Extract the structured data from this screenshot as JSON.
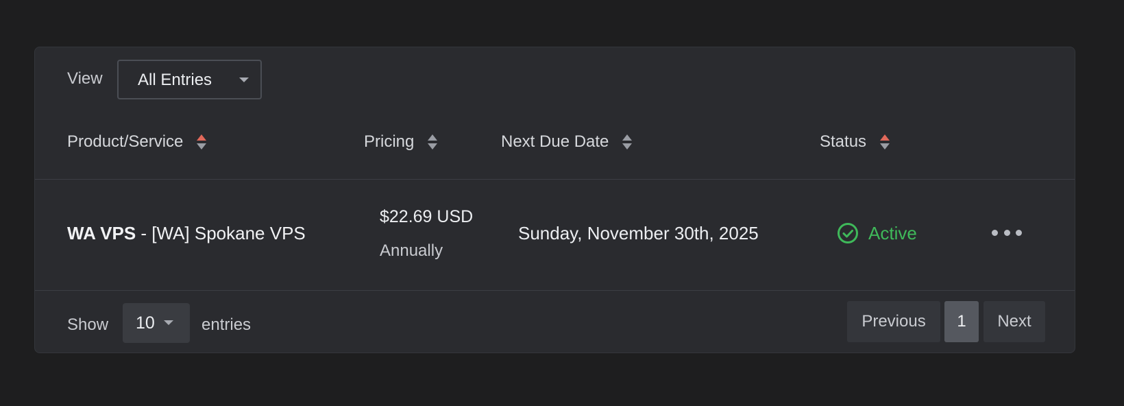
{
  "view": {
    "label": "View",
    "selected": "All Entries"
  },
  "table": {
    "columns": [
      {
        "label": "Product/Service",
        "sort_active": true
      },
      {
        "label": "Pricing",
        "sort_active": false
      },
      {
        "label": "Next Due Date",
        "sort_active": false
      },
      {
        "label": "Status",
        "sort_active": true
      }
    ],
    "rows": [
      {
        "product_group": "WA VPS",
        "product_sep": " - ",
        "product_name": "[WA] Spokane VPS",
        "price": "$22.69 USD",
        "cycle": "Annually",
        "next_due": "Sunday, November 30th, 2025",
        "status": "Active",
        "status_color": "#3fb95a",
        "status_icon": "check-circle-icon",
        "actions_icon": "more-horizontal-icon"
      }
    ]
  },
  "footer": {
    "show_label": "Show",
    "length": "10",
    "entries_label": "entries",
    "previous": "Previous",
    "current_page": "1",
    "next": "Next"
  },
  "colors": {
    "background": "#1e1e1f",
    "card": "#2a2b2f",
    "sort_active": "#e0685a",
    "status_active": "#3fb95a"
  }
}
